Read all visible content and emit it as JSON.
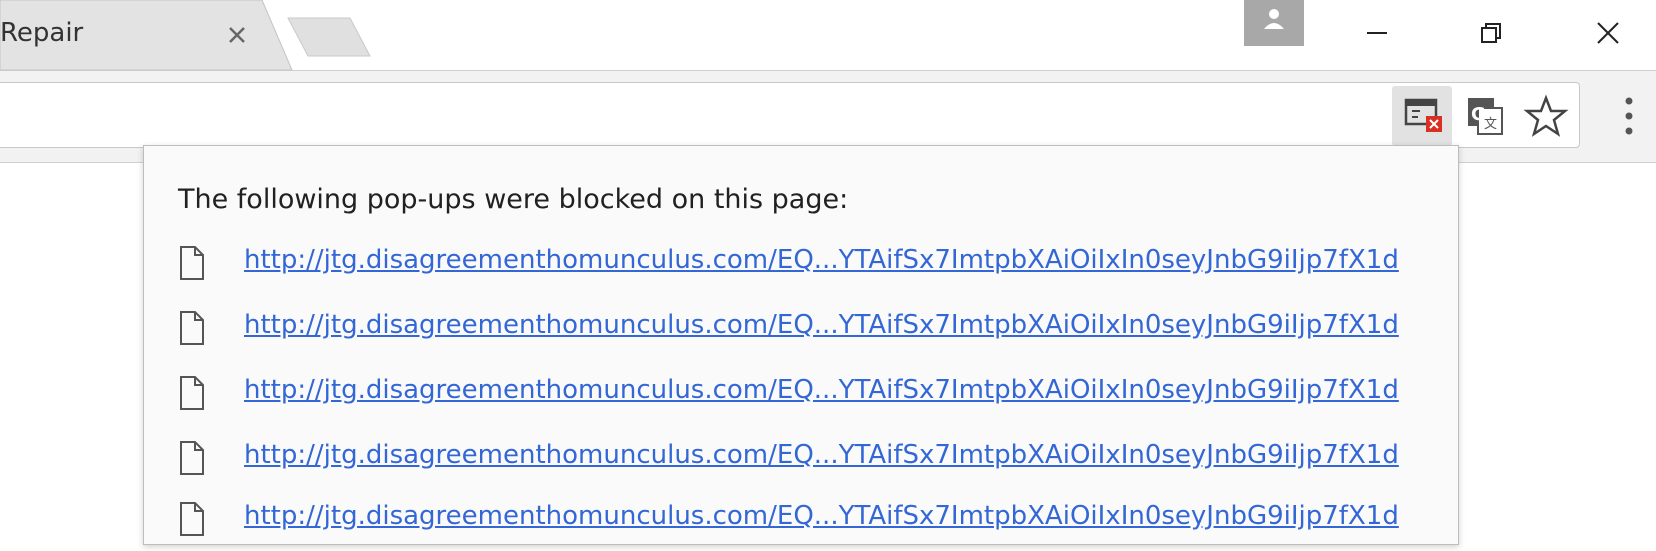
{
  "tab": {
    "title": "Repair",
    "close_icon": "close-icon"
  },
  "window_controls": {
    "minimize": "minimize-icon",
    "restore": "restore-icon",
    "close": "close-icon"
  },
  "toolbar": {
    "icons": [
      "popup-blocked-icon",
      "translate-icon",
      "star-icon",
      "menu-icon"
    ],
    "accent_blocked": "#d93025"
  },
  "popup_bubble": {
    "title": "The following pop-ups were blocked on this page:",
    "links": [
      "http://jtg.disagreementhomunculus.com/EQ...YTAifSx7ImtpbXAiOiIxIn0seyJnbG9iIjp7fX1d",
      "http://jtg.disagreementhomunculus.com/EQ...YTAifSx7ImtpbXAiOiIxIn0seyJnbG9iIjp7fX1d",
      "http://jtg.disagreementhomunculus.com/EQ...YTAifSx7ImtpbXAiOiIxIn0seyJnbG9iIjp7fX1d",
      "http://jtg.disagreementhomunculus.com/EQ...YTAifSx7ImtpbXAiOiIxIn0seyJnbG9iIjp7fX1d",
      "http://jtg.disagreementhomunculus.com/EQ...YTAifSx7ImtpbXAiOiIxIn0seyJnbG9iIjp7fX1d"
    ],
    "link_color": "#3367d6"
  }
}
